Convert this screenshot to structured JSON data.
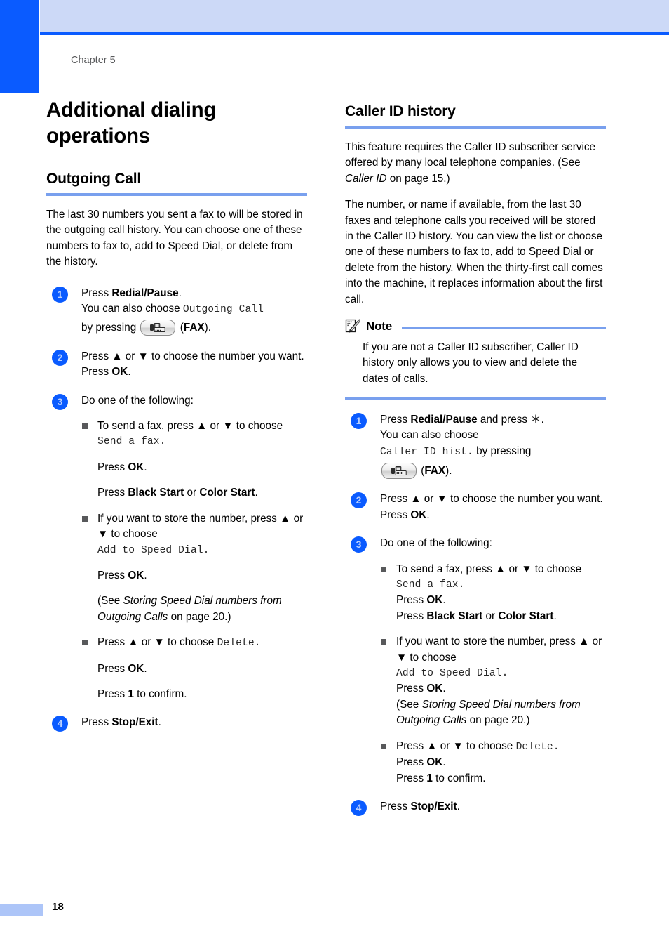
{
  "page": {
    "chapter_label": "Chapter 5",
    "page_number": "18",
    "accent_blue": "#0a5bff",
    "rule_blue": "#79a0ee",
    "header_band": "#ccd9f7"
  },
  "left_column": {
    "chapter_title": "Additional dialing operations",
    "section_title": "Outgoing Call",
    "intro": "The last 30 numbers you sent a fax to will be stored in the outgoing call history. You can choose one of these numbers to fax to, add to Speed Dial, or delete from the history.",
    "steps": [
      {
        "number": "1",
        "line1_pre": "Press ",
        "line1_bold": "Redial/Pause",
        "line1_post": ".",
        "line2_pre": "You can also choose ",
        "line2_mono": "Outgoing Call",
        "line3_pre": "by pressing ",
        "line3_key": "fax-key",
        "line3_post_bold": "FAX",
        "line3_post": ")."
      },
      {
        "number": "2",
        "line1": "Press ▲ or ▼ to choose the number you want.",
        "line2_pre": "Press ",
        "line2_bold": "OK",
        "line2_post": "."
      },
      {
        "number": "3",
        "line1": "Do one of the following:",
        "bullets": [
          {
            "text_pre": "To send a fax, press ▲ or ▼ to choose ",
            "mono": "Send a fax.",
            "paras": [
              {
                "pre": "Press ",
                "bold": "OK",
                "post": "."
              },
              {
                "pre": "Press ",
                "bold": "Black Start",
                "mid": " or ",
                "bold2": "Color Start",
                "post": "."
              }
            ]
          },
          {
            "text_pre": "If you want to store the number, press ▲ or ▼ to choose ",
            "mono": "Add to Speed Dial.",
            "paras": [
              {
                "pre": "Press ",
                "bold": "OK",
                "post": "."
              },
              {
                "pre": "(See ",
                "italic": "Storing Speed Dial numbers from Outgoing Calls",
                "post": " on page 20.)"
              }
            ]
          },
          {
            "text_pre": "Press ▲ or ▼ to choose ",
            "mono": "Delete.",
            "paras": [
              {
                "pre": "Press ",
                "bold": "OK",
                "post": "."
              },
              {
                "pre": "Press ",
                "bold": "1",
                "post": " to confirm."
              }
            ]
          }
        ]
      },
      {
        "number": "4",
        "line1_pre": "Press ",
        "line1_bold": "Stop/Exit",
        "line1_post": "."
      }
    ]
  },
  "right_column": {
    "section_title": "Caller ID history",
    "para1_pre": "This feature requires the Caller ID subscriber service offered by many local telephone companies. (See ",
    "para1_italic": "Caller ID",
    "para1_post": " on page 15.)",
    "para2": "The number, or name if available, from the last 30 faxes and telephone calls you received will be stored in the Caller ID history. You can view the list or choose one of these numbers to fax to, add to Speed Dial or delete from the history. When the thirty-first call comes into the machine, it replaces information about the first call.",
    "note": {
      "title": "Note",
      "icon": "note-pencil-icon",
      "body": "If you are not a Caller ID subscriber, Caller ID history only allows you to view and delete the dates of calls."
    },
    "steps": [
      {
        "number": "1",
        "line1_pre": "Press ",
        "line1_bold": "Redial/Pause",
        "line1_post": " and press ＊.",
        "line2": "You can also choose",
        "line3_mono": "Caller ID hist.",
        "line3_post": " by pressing",
        "line4_key": "fax-key",
        "line4_bold": "FAX",
        "line4_post": ")."
      },
      {
        "number": "2",
        "line1": "Press ▲ or ▼ to choose the number you want.",
        "line2_pre": "Press ",
        "line2_bold": "OK",
        "line2_post": "."
      },
      {
        "number": "3",
        "line1": "Do one of the following:",
        "bullets": [
          {
            "text_pre": "To send a fax, press ▲ or ▼ to choose ",
            "mono": "Send a fax.",
            "paras": [
              {
                "pre": "Press ",
                "bold": "OK",
                "post": "."
              },
              {
                "pre": "Press ",
                "bold": "Black Start",
                "mid": " or ",
                "bold2": "Color Start",
                "post": "."
              }
            ]
          },
          {
            "text_pre": "If you want to store the number, press ▲ or ▼ to choose ",
            "mono": "Add to Speed Dial.",
            "paras": [
              {
                "pre": "Press ",
                "bold": "OK",
                "post": "."
              },
              {
                "pre": "(See ",
                "italic": "Storing Speed Dial numbers from Outgoing Calls",
                "post": " on page 20.)"
              }
            ]
          },
          {
            "text_pre": "Press ▲ or ▼ to choose ",
            "mono": "Delete.",
            "paras": [
              {
                "pre": "Press ",
                "bold": "OK",
                "post": "."
              },
              {
                "pre": "Press ",
                "bold": "1",
                "post": " to confirm."
              }
            ]
          }
        ]
      },
      {
        "number": "4",
        "line1_pre": "Press ",
        "line1_bold": "Stop/Exit",
        "line1_post": "."
      }
    ]
  }
}
